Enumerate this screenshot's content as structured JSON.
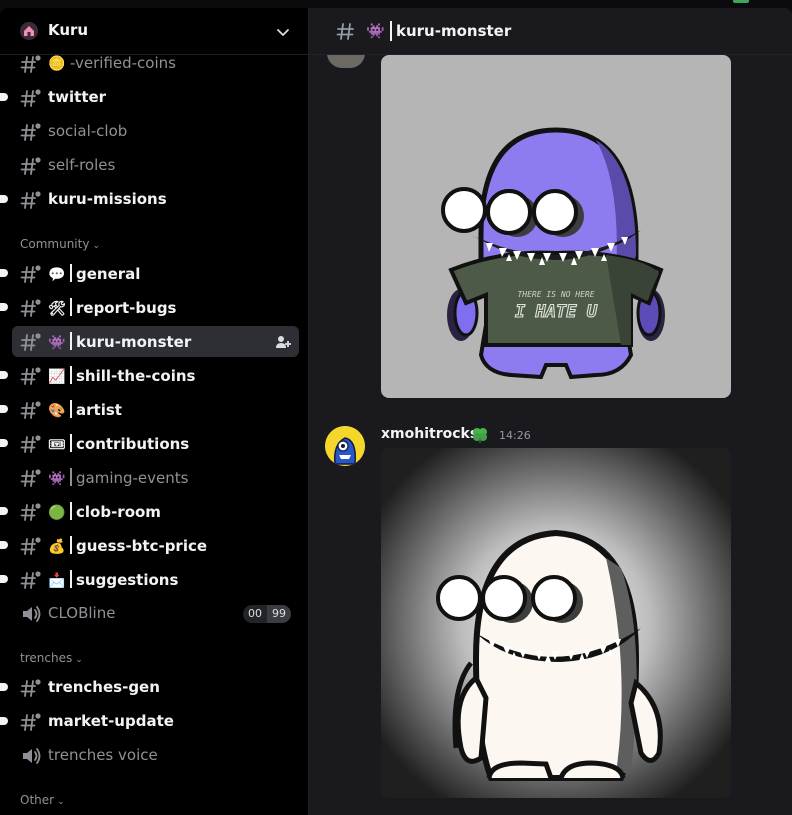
{
  "server": {
    "name": "Kuru"
  },
  "sidebar": {
    "channels_top": [
      {
        "emoji": "🪙",
        "label": "-verified-coins",
        "unread": false
      },
      {
        "emoji": "",
        "label": "twitter",
        "unread": true
      },
      {
        "emoji": "",
        "label": "social-clob",
        "unread": false
      },
      {
        "emoji": "",
        "label": "self-roles",
        "unread": false
      },
      {
        "emoji": "",
        "label": "kuru-missions",
        "unread": true
      }
    ],
    "category_community": "Community",
    "channels_community": [
      {
        "emoji": "💬",
        "label": "general",
        "unread": true
      },
      {
        "emoji": "🛠",
        "label": "report-bugs",
        "unread": true
      },
      {
        "emoji": "👾",
        "label": "kuru-monster",
        "unread": false,
        "active": true
      },
      {
        "emoji": "📈",
        "label": "shill-the-coins",
        "unread": true
      },
      {
        "emoji": "🎨",
        "label": "artist",
        "unread": true
      },
      {
        "emoji": "🎟",
        "label": "contributions",
        "unread": true
      },
      {
        "emoji": "👾",
        "label": "gaming-events",
        "unread": false
      },
      {
        "emoji": "🟢",
        "label": "clob-room",
        "unread": true
      },
      {
        "emoji": "💰",
        "label": "guess-btc-price",
        "unread": true
      },
      {
        "emoji": "📩",
        "label": "suggestions",
        "unread": true
      }
    ],
    "voice_clobline": {
      "label": "CLOBline",
      "count_left": "00",
      "count_right": "99"
    },
    "category_trenches": "trenches",
    "channels_trenches": [
      {
        "label": "trenches-gen",
        "unread": true
      },
      {
        "label": "market-update",
        "unread": true
      }
    ],
    "voice_trenches": {
      "label": "trenches voice"
    },
    "category_other": "Other"
  },
  "channel": {
    "emoji": "👾",
    "title": "kuru-monster"
  },
  "messages": [
    {
      "author": "xmohitrocks",
      "timestamp": "14:26",
      "role_icon": "clover-icon"
    }
  ],
  "image1_text": {
    "line1": "THERE IS NO HERE",
    "line2": "I HATE U"
  },
  "colors": {
    "monster_purple": "#8c7cf0",
    "shirt_green": "#4e5a48",
    "ghost_white": "#fdf7f1"
  }
}
